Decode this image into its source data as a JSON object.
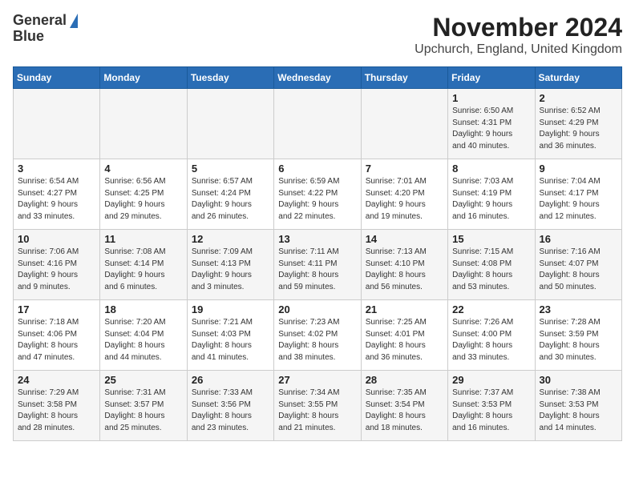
{
  "header": {
    "logo_line1": "General",
    "logo_line2": "Blue",
    "title": "November 2024",
    "subtitle": "Upchurch, England, United Kingdom"
  },
  "columns": [
    "Sunday",
    "Monday",
    "Tuesday",
    "Wednesday",
    "Thursday",
    "Friday",
    "Saturday"
  ],
  "weeks": [
    [
      {
        "day": "",
        "info": ""
      },
      {
        "day": "",
        "info": ""
      },
      {
        "day": "",
        "info": ""
      },
      {
        "day": "",
        "info": ""
      },
      {
        "day": "",
        "info": ""
      },
      {
        "day": "1",
        "info": "Sunrise: 6:50 AM\nSunset: 4:31 PM\nDaylight: 9 hours\nand 40 minutes."
      },
      {
        "day": "2",
        "info": "Sunrise: 6:52 AM\nSunset: 4:29 PM\nDaylight: 9 hours\nand 36 minutes."
      }
    ],
    [
      {
        "day": "3",
        "info": "Sunrise: 6:54 AM\nSunset: 4:27 PM\nDaylight: 9 hours\nand 33 minutes."
      },
      {
        "day": "4",
        "info": "Sunrise: 6:56 AM\nSunset: 4:25 PM\nDaylight: 9 hours\nand 29 minutes."
      },
      {
        "day": "5",
        "info": "Sunrise: 6:57 AM\nSunset: 4:24 PM\nDaylight: 9 hours\nand 26 minutes."
      },
      {
        "day": "6",
        "info": "Sunrise: 6:59 AM\nSunset: 4:22 PM\nDaylight: 9 hours\nand 22 minutes."
      },
      {
        "day": "7",
        "info": "Sunrise: 7:01 AM\nSunset: 4:20 PM\nDaylight: 9 hours\nand 19 minutes."
      },
      {
        "day": "8",
        "info": "Sunrise: 7:03 AM\nSunset: 4:19 PM\nDaylight: 9 hours\nand 16 minutes."
      },
      {
        "day": "9",
        "info": "Sunrise: 7:04 AM\nSunset: 4:17 PM\nDaylight: 9 hours\nand 12 minutes."
      }
    ],
    [
      {
        "day": "10",
        "info": "Sunrise: 7:06 AM\nSunset: 4:16 PM\nDaylight: 9 hours\nand 9 minutes."
      },
      {
        "day": "11",
        "info": "Sunrise: 7:08 AM\nSunset: 4:14 PM\nDaylight: 9 hours\nand 6 minutes."
      },
      {
        "day": "12",
        "info": "Sunrise: 7:09 AM\nSunset: 4:13 PM\nDaylight: 9 hours\nand 3 minutes."
      },
      {
        "day": "13",
        "info": "Sunrise: 7:11 AM\nSunset: 4:11 PM\nDaylight: 8 hours\nand 59 minutes."
      },
      {
        "day": "14",
        "info": "Sunrise: 7:13 AM\nSunset: 4:10 PM\nDaylight: 8 hours\nand 56 minutes."
      },
      {
        "day": "15",
        "info": "Sunrise: 7:15 AM\nSunset: 4:08 PM\nDaylight: 8 hours\nand 53 minutes."
      },
      {
        "day": "16",
        "info": "Sunrise: 7:16 AM\nSunset: 4:07 PM\nDaylight: 8 hours\nand 50 minutes."
      }
    ],
    [
      {
        "day": "17",
        "info": "Sunrise: 7:18 AM\nSunset: 4:06 PM\nDaylight: 8 hours\nand 47 minutes."
      },
      {
        "day": "18",
        "info": "Sunrise: 7:20 AM\nSunset: 4:04 PM\nDaylight: 8 hours\nand 44 minutes."
      },
      {
        "day": "19",
        "info": "Sunrise: 7:21 AM\nSunset: 4:03 PM\nDaylight: 8 hours\nand 41 minutes."
      },
      {
        "day": "20",
        "info": "Sunrise: 7:23 AM\nSunset: 4:02 PM\nDaylight: 8 hours\nand 38 minutes."
      },
      {
        "day": "21",
        "info": "Sunrise: 7:25 AM\nSunset: 4:01 PM\nDaylight: 8 hours\nand 36 minutes."
      },
      {
        "day": "22",
        "info": "Sunrise: 7:26 AM\nSunset: 4:00 PM\nDaylight: 8 hours\nand 33 minutes."
      },
      {
        "day": "23",
        "info": "Sunrise: 7:28 AM\nSunset: 3:59 PM\nDaylight: 8 hours\nand 30 minutes."
      }
    ],
    [
      {
        "day": "24",
        "info": "Sunrise: 7:29 AM\nSunset: 3:58 PM\nDaylight: 8 hours\nand 28 minutes."
      },
      {
        "day": "25",
        "info": "Sunrise: 7:31 AM\nSunset: 3:57 PM\nDaylight: 8 hours\nand 25 minutes."
      },
      {
        "day": "26",
        "info": "Sunrise: 7:33 AM\nSunset: 3:56 PM\nDaylight: 8 hours\nand 23 minutes."
      },
      {
        "day": "27",
        "info": "Sunrise: 7:34 AM\nSunset: 3:55 PM\nDaylight: 8 hours\nand 21 minutes."
      },
      {
        "day": "28",
        "info": "Sunrise: 7:35 AM\nSunset: 3:54 PM\nDaylight: 8 hours\nand 18 minutes."
      },
      {
        "day": "29",
        "info": "Sunrise: 7:37 AM\nSunset: 3:53 PM\nDaylight: 8 hours\nand 16 minutes."
      },
      {
        "day": "30",
        "info": "Sunrise: 7:38 AM\nSunset: 3:53 PM\nDaylight: 8 hours\nand 14 minutes."
      }
    ]
  ]
}
